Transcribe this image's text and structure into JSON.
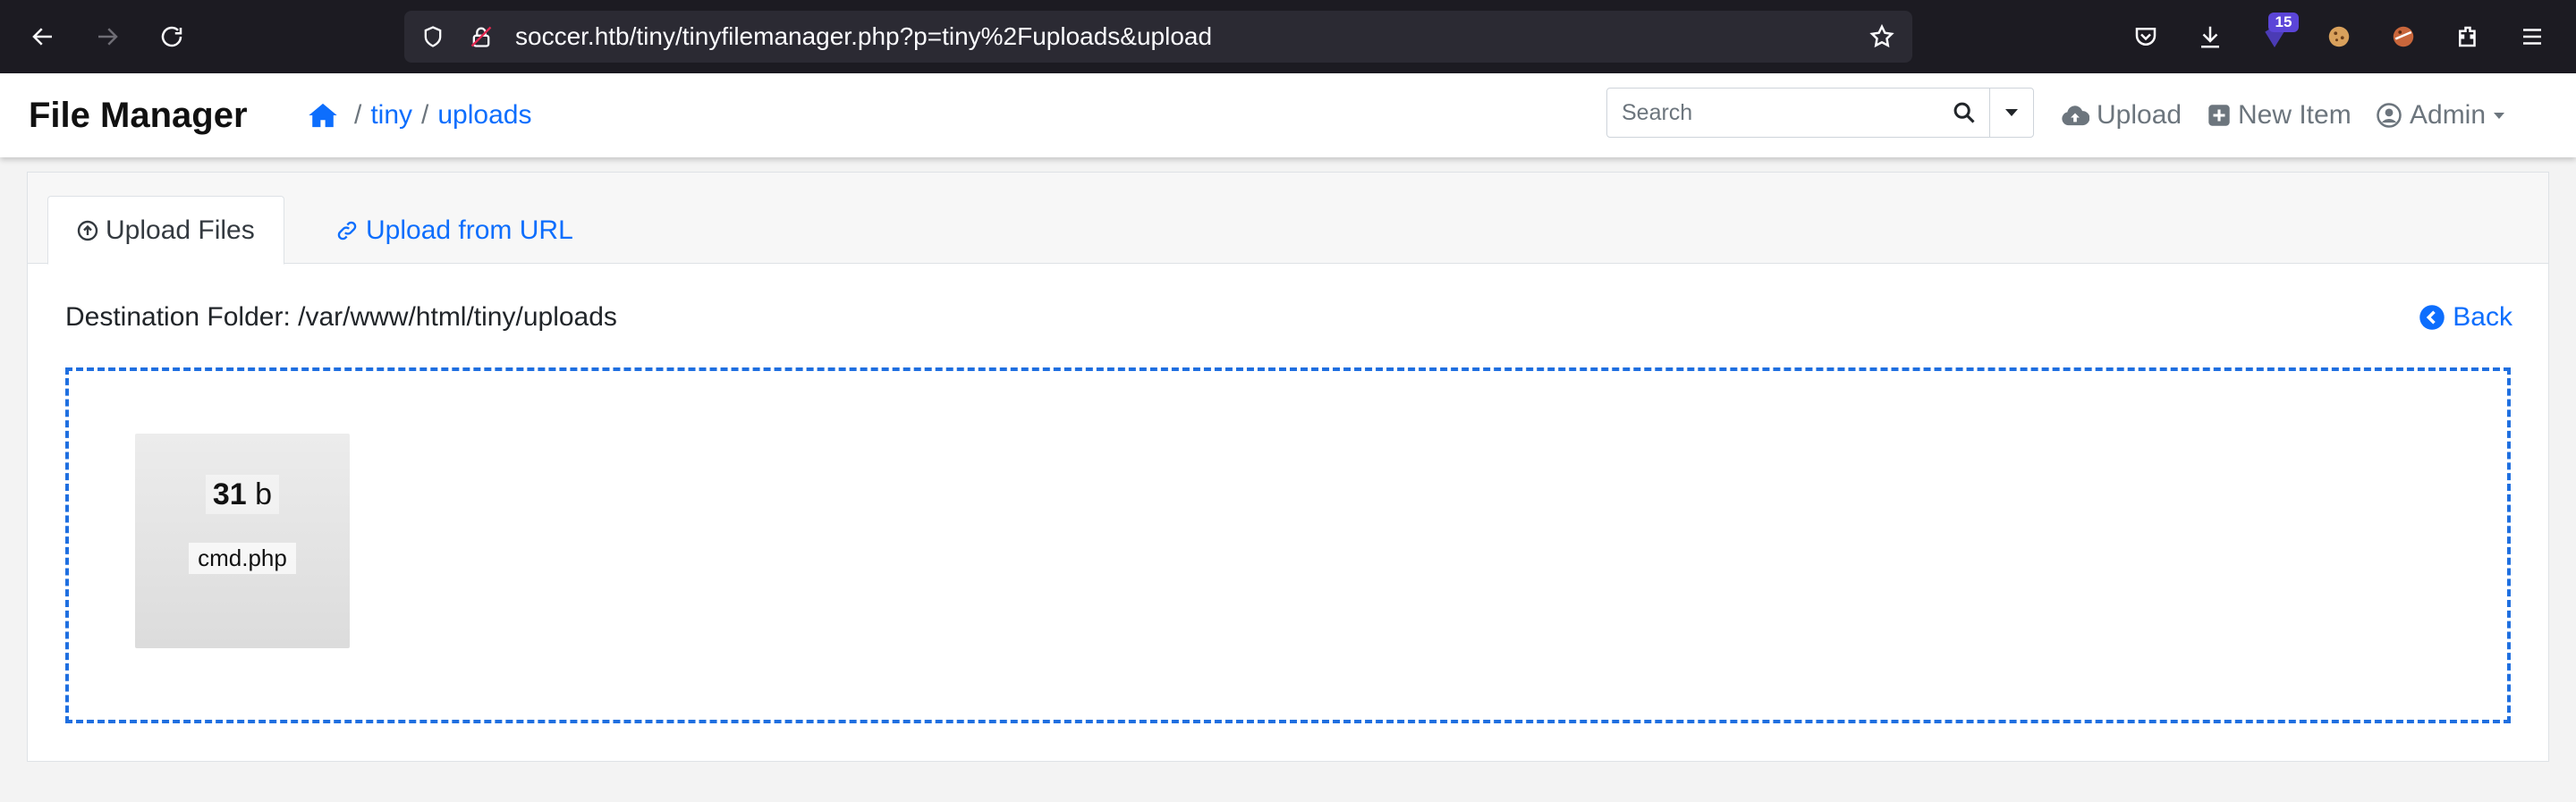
{
  "browser": {
    "url": "soccer.htb/tiny/tinyfilemanager.php?p=tiny%2Fuploads&upload",
    "extension_badge": "15"
  },
  "header": {
    "title": "File Manager",
    "breadcrumb": {
      "home_icon": "home-icon",
      "items": [
        "tiny",
        "uploads"
      ],
      "separator": "/"
    },
    "search": {
      "placeholder": "Search",
      "value": ""
    },
    "actions": {
      "upload": "Upload",
      "new_item": "New Item",
      "admin": "Admin"
    }
  },
  "tabs": [
    {
      "label": "Upload Files",
      "icon": "arrow-up-circle-icon",
      "active": true
    },
    {
      "label": "Upload from URL",
      "icon": "link-icon",
      "active": false
    }
  ],
  "destination": {
    "label": "Destination Folder: /var/www/html/tiny/uploads"
  },
  "back": {
    "label": "Back"
  },
  "dropzone": {
    "files": [
      {
        "size_value": "31",
        "size_unit": "b",
        "name": "cmd.php"
      }
    ]
  },
  "colors": {
    "accent": "#0d6efd",
    "dropzone_border": "#1f6fe0",
    "browser_bar": "#1c1b22"
  }
}
